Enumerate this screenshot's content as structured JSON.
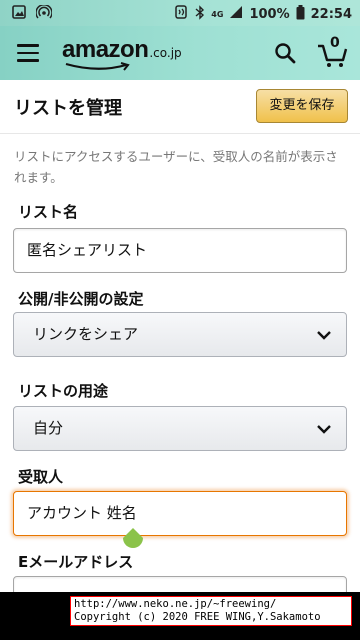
{
  "status_bar": {
    "battery": "100%",
    "time": "22:54",
    "network": "4G"
  },
  "topbar": {
    "logo_text": "amazon",
    "logo_suffix": ".co.jp",
    "cart_count": "0"
  },
  "header": {
    "title": "リストを管理",
    "save_label": "変更を保存"
  },
  "description": "リストにアクセスするユーザーに、受取人の名前が表示されます。",
  "form": {
    "list_name_label": "リスト名",
    "list_name_value": "匿名シェアリスト",
    "privacy_label": "公開/非公開の設定",
    "privacy_value": "リンクをシェア",
    "purpose_label": "リストの用途",
    "purpose_value": "自分",
    "recipient_label": "受取人",
    "recipient_value": "アカウント 姓名",
    "email_label": "Eメールアドレス"
  },
  "copyright": {
    "line1": "http://www.neko.ne.jp/~freewing/",
    "line2": "Copyright (c) 2020 FREE WING,Y.Sakamoto"
  },
  "colors": {
    "topbar": "#9ee0d3",
    "save_button": "#f0c14b",
    "focus": "#e77600"
  }
}
